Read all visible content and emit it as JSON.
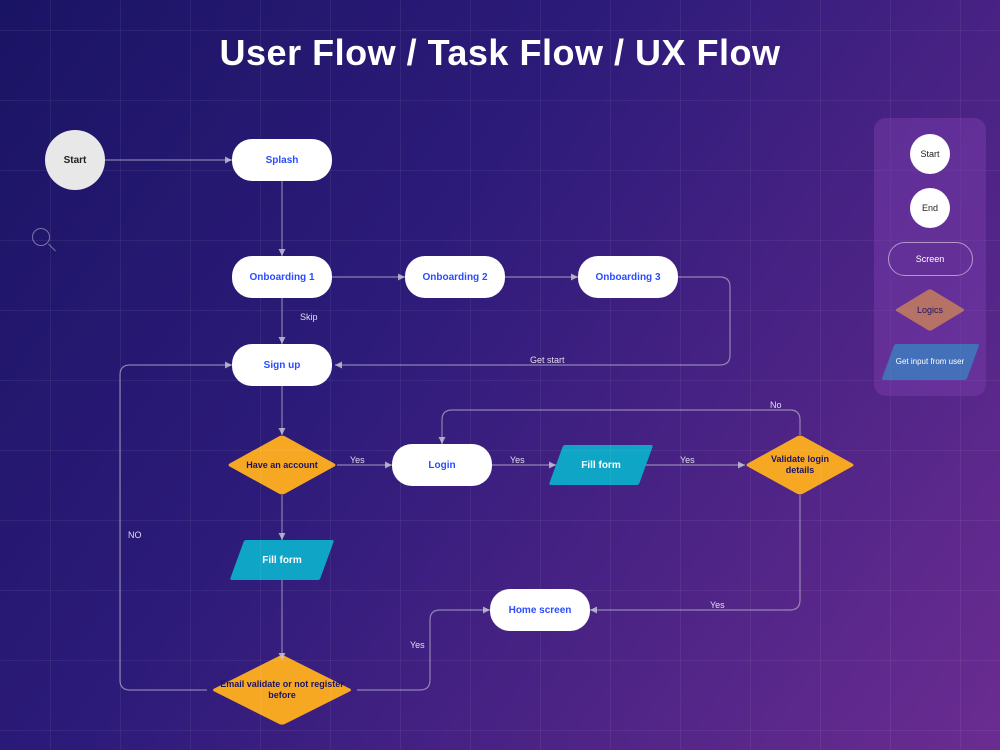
{
  "title": "User Flow  / Task Flow / UX Flow",
  "nodes": {
    "start": "Start",
    "splash": "Splash",
    "onboarding1": "Onboarding 1",
    "onboarding2": "Onboarding 2",
    "onboarding3": "Onboarding 3",
    "signup": "Sign up",
    "have_account": "Have an account",
    "login": "Login",
    "fill_form_login": "Fill form",
    "validate_login": "Validate login details",
    "fill_form_signup": "Fill form",
    "email_validate": "Email validate or not register before",
    "home": "Home screen"
  },
  "edges": {
    "skip": "Skip",
    "get_start": "Get start",
    "yes1": "Yes",
    "yes2": "Yes",
    "yes3": "Yes",
    "yes4": "Yes",
    "yes5": "Yes",
    "no_upper": "No",
    "no_lower": "NO"
  },
  "legend": {
    "start": "Start",
    "end": "End",
    "screen": "Screen",
    "logics": "Logics",
    "input": "Get input from user"
  },
  "colors": {
    "screen_text": "#2b4cff",
    "logic_fill": "#f7a823",
    "input_fill": "#0ea5c6",
    "bg_from": "#1a1464",
    "bg_to": "#6b2c91"
  }
}
